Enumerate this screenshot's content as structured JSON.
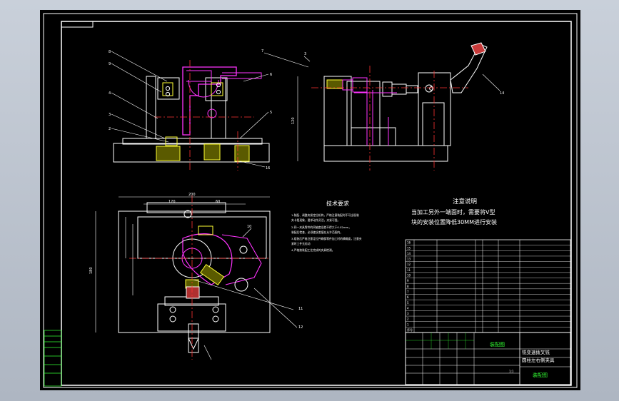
{
  "drawing": {
    "tech_req": {
      "title": "技术要求",
      "lines": [
        "1.装配、调整夹紧定位机构，严格注意装配时不可出现装",
        "夹卡阻现象，要求动作灵活，夹紧可靠。",
        "2.同一夹具零件的同轴度误差不得大于0.02mm，",
        "装配后检查，必须使误差值在允许范围内。",
        "3.组装后严格注意定位件确保零件加工时的精确度，注意夹",
        "紧时工件无松动",
        "4.严格按装配工艺完成的夹具检测。"
      ]
    },
    "note": {
      "title": "注意说明",
      "lines": [
        "当加工另外一端面时，需要将V型",
        "块的安装位置降低30MM进行安装"
      ]
    },
    "title_block": {
      "assembly_label": "装配图",
      "name_line1": "铣变速拨叉铣",
      "name_line2": "圆柱左右侧夹具",
      "drawing_type": "装配图",
      "scale": "1:1"
    },
    "bom_numbers": [
      "16",
      "15",
      "14",
      "13",
      "12",
      "11",
      "10",
      "9",
      "8",
      "7",
      "6",
      "5",
      "4",
      "3",
      "2",
      "1",
      "序号"
    ]
  }
}
